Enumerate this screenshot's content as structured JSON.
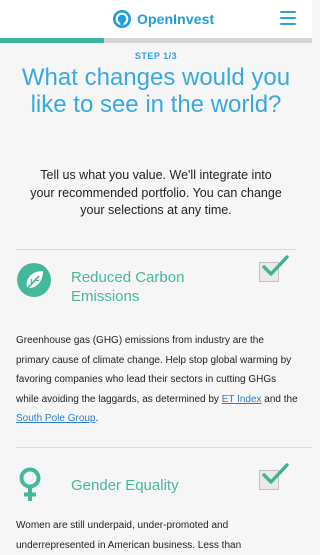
{
  "brand": {
    "name": "OpenInvest",
    "color": "#1e9ed9",
    "logo_icon": "openinvest-logo-icon"
  },
  "header": {
    "menu_icon": "hamburger-menu-icon"
  },
  "progress": {
    "fraction": 0.333,
    "color": "#3cb4a0"
  },
  "step": {
    "label": "STEP 1/3"
  },
  "headline": "What changes would you like to see in the world?",
  "intro": "Tell us what you value. We'll integrate into your recommended portfolio. You can change your selections at any time.",
  "values": [
    {
      "icon": "leaf-icon",
      "title": "Reduced Carbon Emissions",
      "checked": true,
      "description": {
        "before": "Greenhouse gas (GHG) emissions from industry are the primary cause of climate change. Help stop global warming by favoring companies who lead their sectors in cutting GHGs while avoiding the laggards, as determined by ",
        "link1": "ET Index",
        "middle": " and the ",
        "link2": "South Pole Group",
        "after": "."
      }
    },
    {
      "icon": "female-symbol-icon",
      "title": "Gender Equality",
      "checked": true,
      "description": {
        "before": "Women are still underpaid, under-promoted and underrepresented in American business. Less than"
      }
    }
  ]
}
